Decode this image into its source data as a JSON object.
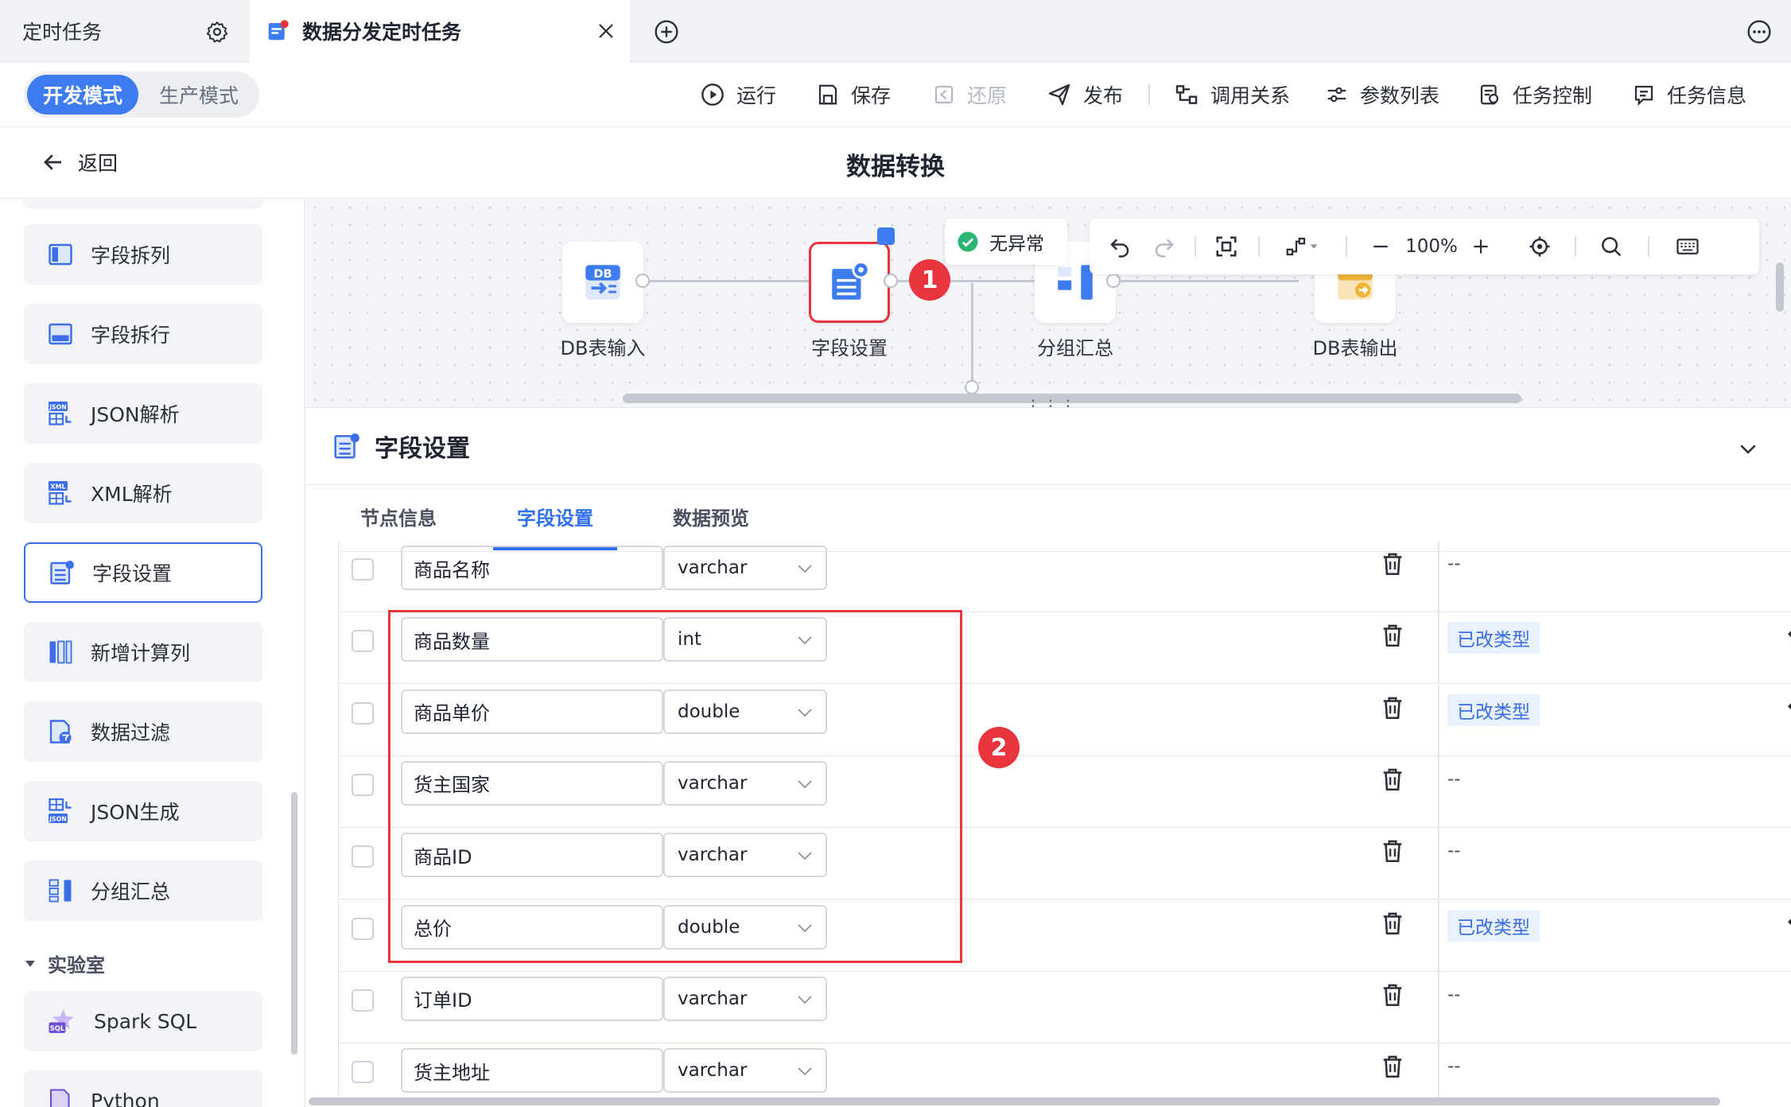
{
  "tabbar": {
    "tab_left": "定时任务",
    "tab_active": "数据分发定时任务"
  },
  "toolbar": {
    "mode_dev": "开发模式",
    "mode_prod": "生产模式",
    "run": "运行",
    "save": "保存",
    "restore": "还原",
    "publish": "发布",
    "call_relation": "调用关系",
    "param_list": "参数列表",
    "task_control": "任务控制",
    "task_info": "任务信息"
  },
  "titlerow": {
    "back": "返回",
    "title": "数据转换"
  },
  "sidebar": {
    "items": [
      {
        "label": "字段拆列",
        "icon": "split-columns-icon"
      },
      {
        "label": "字段拆行",
        "icon": "split-rows-icon"
      },
      {
        "label": "JSON解析",
        "icon": "json-parse-icon"
      },
      {
        "label": "XML解析",
        "icon": "xml-parse-icon"
      },
      {
        "label": "字段设置",
        "icon": "field-settings-icon",
        "active": true
      },
      {
        "label": "新增计算列",
        "icon": "add-calc-column-icon"
      },
      {
        "label": "数据过滤",
        "icon": "data-filter-icon"
      },
      {
        "label": "JSON生成",
        "icon": "json-generate-icon"
      },
      {
        "label": "分组汇总",
        "icon": "group-summary-icon"
      }
    ],
    "lab_group": "实验室",
    "lab_items": [
      {
        "label": "Spark SQL",
        "icon": "spark-sql-icon"
      },
      {
        "label": "Python",
        "icon": "python-icon"
      }
    ]
  },
  "canvas": {
    "status": "无异常",
    "zoom": "100%",
    "nodes": [
      {
        "label": "DB表输入"
      },
      {
        "label": "字段设置"
      },
      {
        "label": "分组汇总"
      },
      {
        "label": "DB表输出"
      }
    ],
    "marker1": "1"
  },
  "panel": {
    "title": "字段设置",
    "tabs": [
      "节点信息",
      "字段设置",
      "数据预览"
    ],
    "active_tab": 1,
    "marker2": "2",
    "rows": [
      {
        "name": "商品名称",
        "type": "varchar",
        "status": "--",
        "changed": false
      },
      {
        "name": "商品数量",
        "type": "int",
        "status": "已改类型",
        "changed": true
      },
      {
        "name": "商品单价",
        "type": "double",
        "status": "已改类型",
        "changed": true
      },
      {
        "name": "货主国家",
        "type": "varchar",
        "status": "--",
        "changed": false
      },
      {
        "name": "商品ID",
        "type": "varchar",
        "status": "--",
        "changed": false
      },
      {
        "name": "总价",
        "type": "double",
        "status": "已改类型",
        "changed": true
      },
      {
        "name": "订单ID",
        "type": "varchar",
        "status": "--",
        "changed": false
      },
      {
        "name": "货主地址",
        "type": "varchar",
        "status": "--",
        "changed": false
      }
    ]
  },
  "colors": {
    "accent": "#3c7cf0",
    "highlight": "#e8343c",
    "badge_bg": "#e9f0fe"
  }
}
